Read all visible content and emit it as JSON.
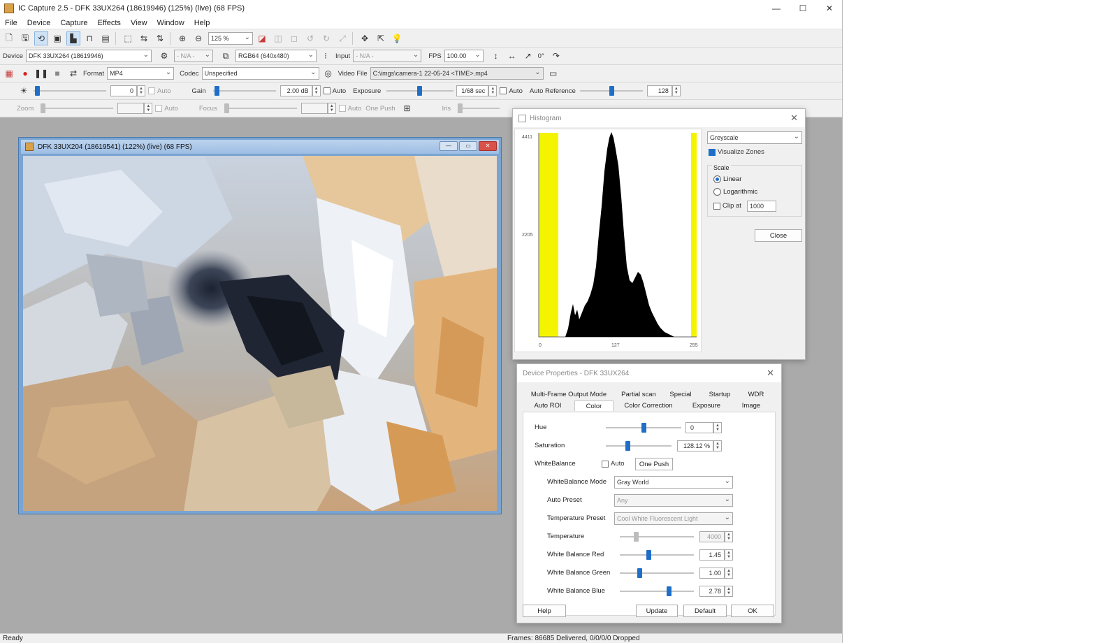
{
  "window": {
    "title": "IC Capture 2.5 - DFK 33UX264 (18619946) (125%) (live) (68 FPS)",
    "controls": [
      "—",
      "☐",
      "✕"
    ]
  },
  "menu": [
    "File",
    "Device",
    "Capture",
    "Effects",
    "View",
    "Window",
    "Help"
  ],
  "toolbar1": {
    "zoom_value": "125 %"
  },
  "toolbar2": {
    "device_label": "Device",
    "device_value": "DFK 33UX264 (18619946)",
    "na1": "- N/A -",
    "format_value": "RGB64 (640x480)",
    "input_label": "Input",
    "input_value": "- N/A -",
    "fps_label": "FPS",
    "fps_value": "100.00",
    "rotate_value": "0°"
  },
  "toolbar3": {
    "format_label": "Format",
    "format_value": "MP4",
    "codec_label": "Codec",
    "codec_value": "Unspecified",
    "videofile_label": "Video File",
    "videofile_value": "C:\\imgs\\camera-1 22-05-24 <TIME>.mp4"
  },
  "toolbar4": {
    "brightness_value": "0",
    "auto1": "Auto",
    "gain_label": "Gain",
    "gain_value": "2.00 dB",
    "auto2": "Auto",
    "exposure_label": "Exposure",
    "exposure_value": "1/68 sec",
    "auto3": "Auto",
    "autoref_label": "Auto Reference",
    "autoref_value": "128"
  },
  "toolbar5": {
    "zoom_label": "Zoom",
    "auto4": "Auto",
    "focus_label": "Focus",
    "auto5": "Auto",
    "onepush_label": "One Push",
    "iris_label": "Iris"
  },
  "child_window": {
    "title": "DFK 33UX204 (18619541) (122%) (live) (68 FPS)"
  },
  "histogram": {
    "title": "Histogram",
    "ytick_top": "4411",
    "ytick_mid": "2205",
    "xticks": [
      "0",
      "127",
      "255"
    ],
    "mode_value": "Greyscale",
    "visualize_zones": "Visualize Zones",
    "scale_label": "Scale",
    "linear": "Linear",
    "logarithmic": "Logarithmic",
    "clip_at": "Clip at",
    "clip_value": "1000",
    "close_button": "Close",
    "bar_color": "#000000",
    "zone_color": "#f4f400"
  },
  "device_properties": {
    "title": "Device Properties - DFK 33UX264",
    "tabs_row1": [
      "Multi-Frame Output Mode",
      "Partial scan",
      "Special",
      "Startup",
      "WDR"
    ],
    "tabs_row2": [
      "Auto ROI",
      "Color",
      "Color Correction",
      "Exposure",
      "Image"
    ],
    "active_tab": "Color",
    "hue_label": "Hue",
    "hue_value": "0",
    "hue_level": 0.5,
    "saturation_label": "Saturation",
    "saturation_value": "128.12 %",
    "saturation_level": 0.32,
    "whitebalance_label": "WhiteBalance",
    "auto_label": "Auto",
    "onepush_button": "One Push",
    "wb_mode_label": "WhiteBalance Mode",
    "wb_mode_value": "Gray World",
    "auto_preset_label": "Auto Preset",
    "auto_preset_value": "Any",
    "temp_preset_label": "Temperature Preset",
    "temp_preset_value": "Cool White Fluorescent Light",
    "temperature_label": "Temperature",
    "temperature_value": "4000",
    "temperature_level": 0.2,
    "wb_red_label": "White Balance Red",
    "wb_red_value": "1.45",
    "wb_red_level": 0.38,
    "wb_green_label": "White Balance Green",
    "wb_green_value": "1.00",
    "wb_green_level": 0.25,
    "wb_blue_label": "White Balance Blue",
    "wb_blue_value": "2.78",
    "wb_blue_level": 0.68,
    "help_button": "Help",
    "update_button": "Update",
    "default_button": "Default",
    "ok_button": "OK"
  },
  "status": {
    "ready": "Ready",
    "frames": "Frames: 86685 Delivered, 0/0/0/0 Dropped"
  }
}
